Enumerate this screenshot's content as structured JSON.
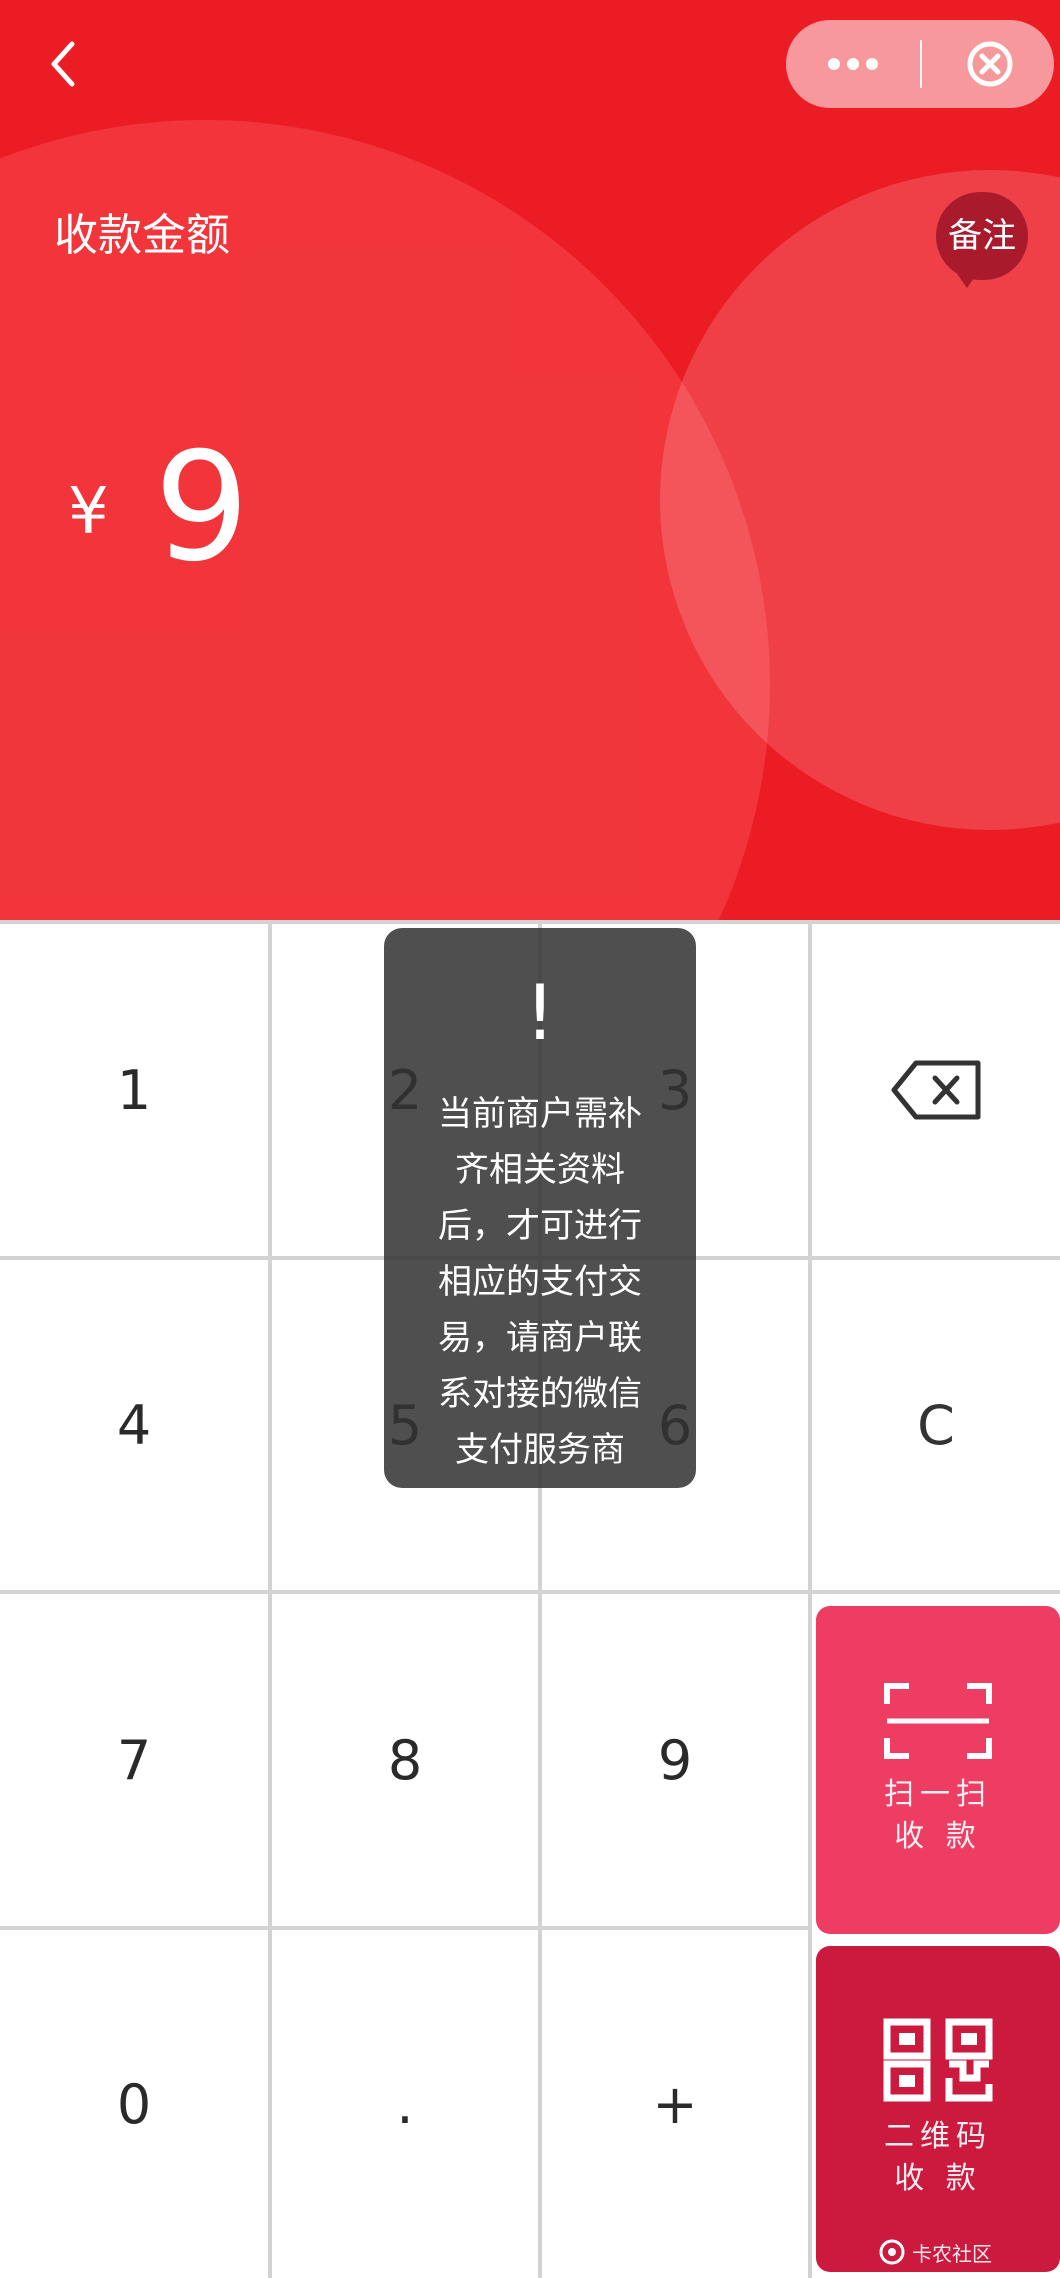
{
  "header": {
    "back_icon": "chevron-left-icon",
    "more_icon": "more-dots-icon",
    "close_icon": "close-circle-icon",
    "amount_label": "收款金额",
    "note_button": "备注",
    "currency_symbol": "¥",
    "amount_value": "9",
    "accent_color": "#ec1c24"
  },
  "keypad": {
    "keys": [
      "1",
      "2",
      "3",
      "4",
      "5",
      "6",
      "7",
      "8",
      "9",
      "0",
      ".",
      "+"
    ],
    "backspace_icon": "backspace-icon",
    "clear_label": "C",
    "scan_pay": {
      "icon": "scan-icon",
      "line1": "扫一扫",
      "line2": "收 款",
      "color": "#ee3d62"
    },
    "qr_pay": {
      "icon": "qr-code-icon",
      "line1": "二维码",
      "line2": "收 款",
      "color": "#cc1a3f"
    }
  },
  "toast": {
    "icon": "exclamation-icon",
    "mark": "!",
    "message": "当前商户需补齐相关资料后，才可进行相应的支付交易，请商户联系对接的微信支付服务商"
  },
  "watermark": {
    "text": "卡农社区"
  }
}
